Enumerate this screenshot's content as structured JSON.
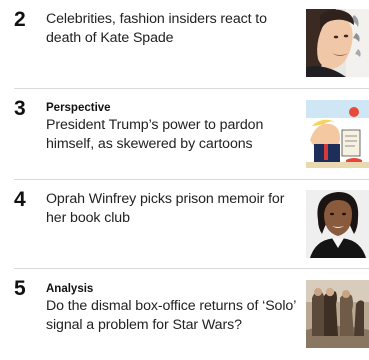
{
  "most_read": {
    "items": [
      {
        "rank": "2",
        "kicker": "",
        "headline": "Celebrities, fashion insiders react to death of Kate Spade",
        "thumbnail": "kate-spade-portrait-photo"
      },
      {
        "rank": "3",
        "kicker": "Perspective",
        "headline": "President Trump’s power to pardon himself, as skewered by cartoons",
        "thumbnail": "trump-pardon-cartoon"
      },
      {
        "rank": "4",
        "kicker": "",
        "headline": "Oprah Winfrey picks prison memoir for her book club",
        "thumbnail": "oprah-winfrey-portrait-photo"
      },
      {
        "rank": "5",
        "kicker": "Analysis",
        "headline": "Do the dismal box-office returns of ‘Solo’ signal a problem for Star Wars?",
        "thumbnail": "solo-star-wars-still-photo"
      }
    ]
  }
}
